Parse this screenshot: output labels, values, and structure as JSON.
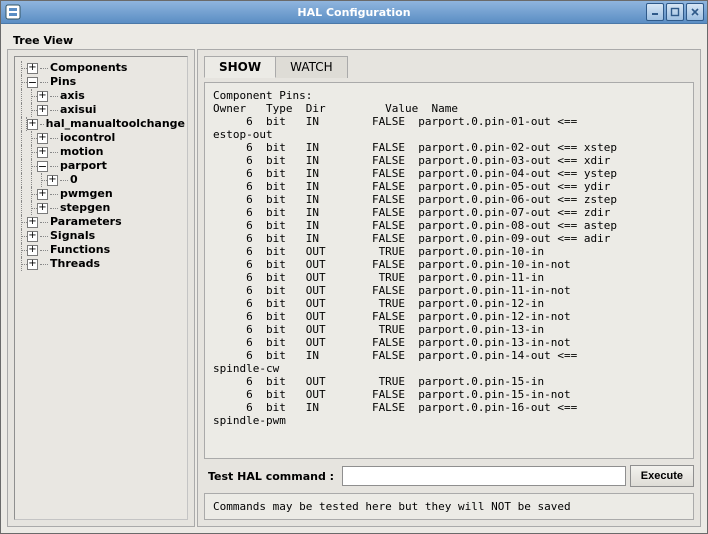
{
  "window": {
    "title": "HAL Configuration"
  },
  "toolbar": {
    "tree_view": "Tree View"
  },
  "tree": [
    {
      "depth": 0,
      "expander": "plus",
      "label": "Components"
    },
    {
      "depth": 0,
      "expander": "minus",
      "label": "Pins"
    },
    {
      "depth": 1,
      "expander": "plus",
      "label": "axis"
    },
    {
      "depth": 1,
      "expander": "plus",
      "label": "axisui"
    },
    {
      "depth": 1,
      "expander": "plus",
      "label": "hal_manualtoolchange"
    },
    {
      "depth": 1,
      "expander": "plus",
      "label": "iocontrol"
    },
    {
      "depth": 1,
      "expander": "plus",
      "label": "motion"
    },
    {
      "depth": 1,
      "expander": "minus",
      "label": "parport"
    },
    {
      "depth": 2,
      "expander": "plus",
      "label": "0"
    },
    {
      "depth": 1,
      "expander": "plus",
      "label": "pwmgen"
    },
    {
      "depth": 1,
      "expander": "plus",
      "label": "stepgen"
    },
    {
      "depth": 0,
      "expander": "plus",
      "label": "Parameters"
    },
    {
      "depth": 0,
      "expander": "plus",
      "label": "Signals"
    },
    {
      "depth": 0,
      "expander": "plus",
      "label": "Functions"
    },
    {
      "depth": 0,
      "expander": "plus",
      "label": "Threads"
    }
  ],
  "tabs": {
    "show": "SHOW",
    "watch": "WATCH",
    "active": "show"
  },
  "output": {
    "header1": "Component Pins:",
    "header2": "Owner   Type  Dir         Value  Name",
    "rows": [
      {
        "owner": "6",
        "type": "bit",
        "dir": "IN",
        "value": "FALSE",
        "name": "parport.0.pin-01-out <== estop-out",
        "wrap": true
      },
      {
        "owner": "6",
        "type": "bit",
        "dir": "IN",
        "value": "FALSE",
        "name": "parport.0.pin-02-out <== xstep"
      },
      {
        "owner": "6",
        "type": "bit",
        "dir": "IN",
        "value": "FALSE",
        "name": "parport.0.pin-03-out <== xdir"
      },
      {
        "owner": "6",
        "type": "bit",
        "dir": "IN",
        "value": "FALSE",
        "name": "parport.0.pin-04-out <== ystep"
      },
      {
        "owner": "6",
        "type": "bit",
        "dir": "IN",
        "value": "FALSE",
        "name": "parport.0.pin-05-out <== ydir"
      },
      {
        "owner": "6",
        "type": "bit",
        "dir": "IN",
        "value": "FALSE",
        "name": "parport.0.pin-06-out <== zstep"
      },
      {
        "owner": "6",
        "type": "bit",
        "dir": "IN",
        "value": "FALSE",
        "name": "parport.0.pin-07-out <== zdir"
      },
      {
        "owner": "6",
        "type": "bit",
        "dir": "IN",
        "value": "FALSE",
        "name": "parport.0.pin-08-out <== astep"
      },
      {
        "owner": "6",
        "type": "bit",
        "dir": "IN",
        "value": "FALSE",
        "name": "parport.0.pin-09-out <== adir"
      },
      {
        "owner": "6",
        "type": "bit",
        "dir": "OUT",
        "value": "TRUE",
        "name": "parport.0.pin-10-in"
      },
      {
        "owner": "6",
        "type": "bit",
        "dir": "OUT",
        "value": "FALSE",
        "name": "parport.0.pin-10-in-not"
      },
      {
        "owner": "6",
        "type": "bit",
        "dir": "OUT",
        "value": "TRUE",
        "name": "parport.0.pin-11-in"
      },
      {
        "owner": "6",
        "type": "bit",
        "dir": "OUT",
        "value": "FALSE",
        "name": "parport.0.pin-11-in-not"
      },
      {
        "owner": "6",
        "type": "bit",
        "dir": "OUT",
        "value": "TRUE",
        "name": "parport.0.pin-12-in"
      },
      {
        "owner": "6",
        "type": "bit",
        "dir": "OUT",
        "value": "FALSE",
        "name": "parport.0.pin-12-in-not"
      },
      {
        "owner": "6",
        "type": "bit",
        "dir": "OUT",
        "value": "TRUE",
        "name": "parport.0.pin-13-in"
      },
      {
        "owner": "6",
        "type": "bit",
        "dir": "OUT",
        "value": "FALSE",
        "name": "parport.0.pin-13-in-not"
      },
      {
        "owner": "6",
        "type": "bit",
        "dir": "IN",
        "value": "FALSE",
        "name": "parport.0.pin-14-out <== spindle-cw",
        "wrap": true
      },
      {
        "owner": "6",
        "type": "bit",
        "dir": "OUT",
        "value": "TRUE",
        "name": "parport.0.pin-15-in"
      },
      {
        "owner": "6",
        "type": "bit",
        "dir": "OUT",
        "value": "FALSE",
        "name": "parport.0.pin-15-in-not"
      },
      {
        "owner": "6",
        "type": "bit",
        "dir": "IN",
        "value": "FALSE",
        "name": "parport.0.pin-16-out <== spindle-pwm",
        "wrap": true
      }
    ]
  },
  "command": {
    "label": "Test HAL command :",
    "value": "",
    "execute": "Execute"
  },
  "hint": "Commands may be tested here but they will NOT be saved"
}
